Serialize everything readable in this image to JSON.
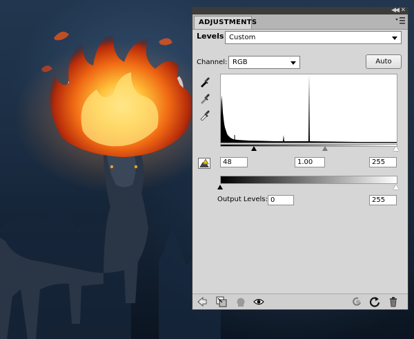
{
  "panel": {
    "tab_label": "ADJUSTMENTS",
    "adjustment_name": "Levels",
    "preset_value": "Custom",
    "channel_label": "Channel:",
    "channel_value": "RGB",
    "auto_label": "Auto",
    "input_levels": {
      "black": "48",
      "gamma": "1.00",
      "white": "255"
    },
    "output_label": "Output Levels:",
    "output_levels": {
      "black": "0",
      "white": "255"
    }
  },
  "icons": {
    "topbar": [
      "collapse-icon",
      "close-icon"
    ],
    "panel_menu": "panel-menu-icon",
    "eyedroppers": [
      "black-eyedropper-icon",
      "gray-eyedropper-icon",
      "white-eyedropper-icon"
    ],
    "clipping": "clipping-warning-icon",
    "bottom": [
      "back-arrow-icon",
      "clip-to-layer-icon",
      "visibility-toggle-icon",
      "eye-icon",
      "view-previous-state-icon",
      "reset-icon",
      "trash-icon"
    ]
  },
  "colors": {
    "panel_bg": "#d6d6d6",
    "topbar_bg": "#3c3c3c",
    "tab_strip_bg": "#b5b5b5"
  }
}
